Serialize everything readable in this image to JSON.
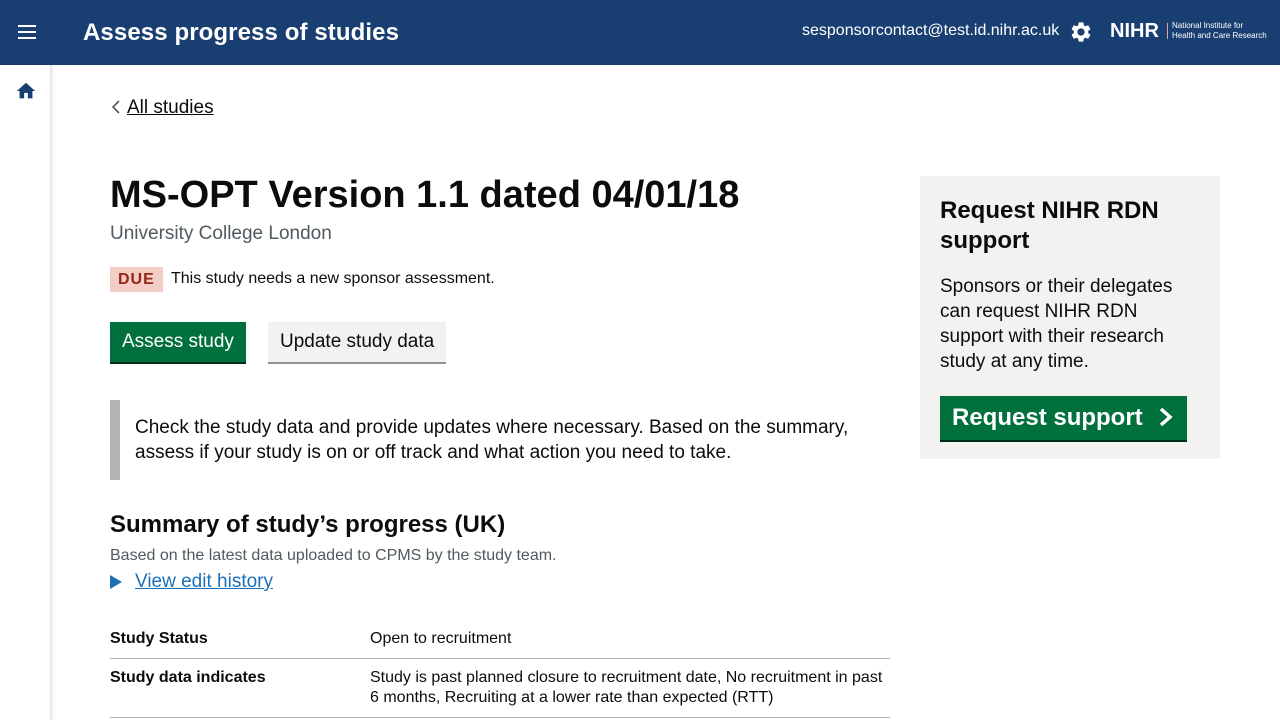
{
  "header": {
    "app_title": "Assess progress of studies",
    "user_email": "sesponsorcontact@test.id.nihr.ac.uk",
    "logo_text": "NIHR",
    "logo_subtitle_line1": "National Institute for",
    "logo_subtitle_line2": "Health and Care Research"
  },
  "nav": {
    "back_link_label": "All studies"
  },
  "study": {
    "title": "MS-OPT Version 1.1 dated 04/01/18",
    "organisation": "University College London",
    "status_tag": "DUE",
    "status_text": "This study needs a new sponsor assessment."
  },
  "actions": {
    "assess_label": "Assess study",
    "update_label": "Update study data"
  },
  "inset_text": "Check the study data and provide updates where necessary. Based on the summary, assess if your study is on or off track and what action you need to take.",
  "summary": {
    "heading": "Summary of study’s progress (UK)",
    "subheading": "Based on the latest data uploaded to CPMS by the study team.",
    "details_label": "View edit history",
    "rows": [
      {
        "key": "Study Status",
        "value": "Open to recruitment"
      },
      {
        "key": "Study data indicates",
        "value": "Study is past planned closure to recruitment date, No recruitment in past 6 months, Recruiting at a lower rate than expected (RTT)"
      }
    ]
  },
  "aside": {
    "heading": "Request NIHR RDN support",
    "body": "Sponsors or their delegates can request NIHR RDN support with their research study at any time.",
    "button_label": "Request support"
  },
  "colors": {
    "header_bg": "#193e72",
    "primary_button": "#00703c",
    "link": "#1d70b8",
    "tag_bg": "#f4cdc6",
    "tag_text": "#942514"
  },
  "icons": {
    "menu": "menu-icon",
    "settings": "gear-icon",
    "home": "home-icon",
    "back": "chevron-left-icon",
    "details": "triangle-right-icon",
    "start": "chevron-right-icon"
  }
}
